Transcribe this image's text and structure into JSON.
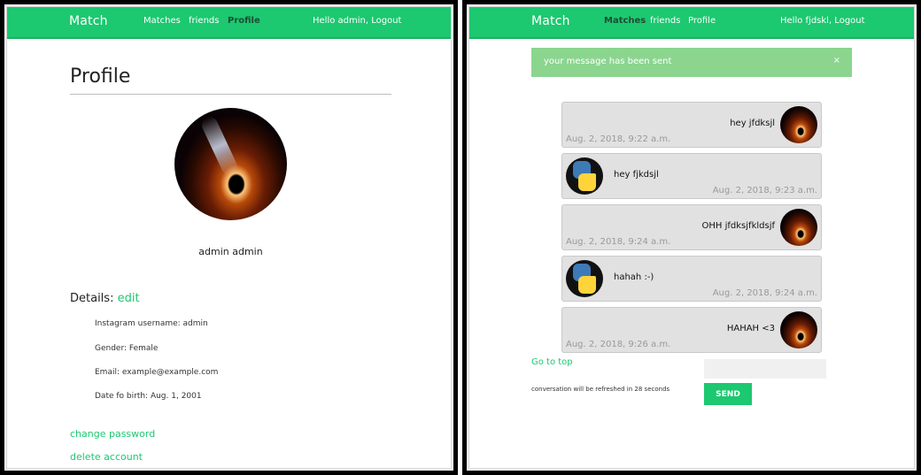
{
  "left": {
    "nav": {
      "brand": "Match",
      "links": [
        "Matches",
        "friends",
        "Profile"
      ],
      "right": "Hello admin, Logout"
    },
    "title": "Profile",
    "fullname": "admin admin",
    "details_label": "Details:",
    "edit_label": "edit",
    "details": [
      "Instagram username: admin",
      "Gender: Female",
      "Email: example@example.com",
      "Date fo birth: Aug. 1, 2001"
    ],
    "links": [
      "change password",
      "delete account"
    ]
  },
  "right": {
    "nav": {
      "brand": "Match",
      "links": [
        "Matches",
        "friends",
        "Profile"
      ],
      "right": "Hello fjdskl, Logout"
    },
    "alert": {
      "text": "your message has been sent",
      "close": "×"
    },
    "messages": [
      {
        "text": "hey jfdksjl",
        "time": "Aug. 2, 2018, 9:22 a.m.",
        "side": "mine",
        "avatar": "black-hole-icon"
      },
      {
        "text": "hey fjkdsjl",
        "time": "Aug. 2, 2018, 9:23 a.m.",
        "side": "theirs",
        "avatar": "python-logo-icon"
      },
      {
        "text": "OHH jfdksjfkldsjf",
        "time": "Aug. 2, 2018, 9:24 a.m.",
        "side": "mine",
        "avatar": "black-hole-icon"
      },
      {
        "text": "hahah :-)",
        "time": "Aug. 2, 2018, 9:24 a.m.",
        "side": "theirs",
        "avatar": "python-logo-icon"
      },
      {
        "text": "HAHAH <3",
        "time": "Aug. 2, 2018, 9:26 a.m.",
        "side": "mine",
        "avatar": "black-hole-icon"
      }
    ],
    "go_to_top": "Go to top",
    "refresh_note": "conversation will be refreshed in 28 seconds",
    "input_value": "",
    "send_label": "SEND"
  },
  "colors": {
    "accent": "#1cc870",
    "alert_bg": "#8bd58f",
    "bubble_bg": "#e1e1e1"
  }
}
